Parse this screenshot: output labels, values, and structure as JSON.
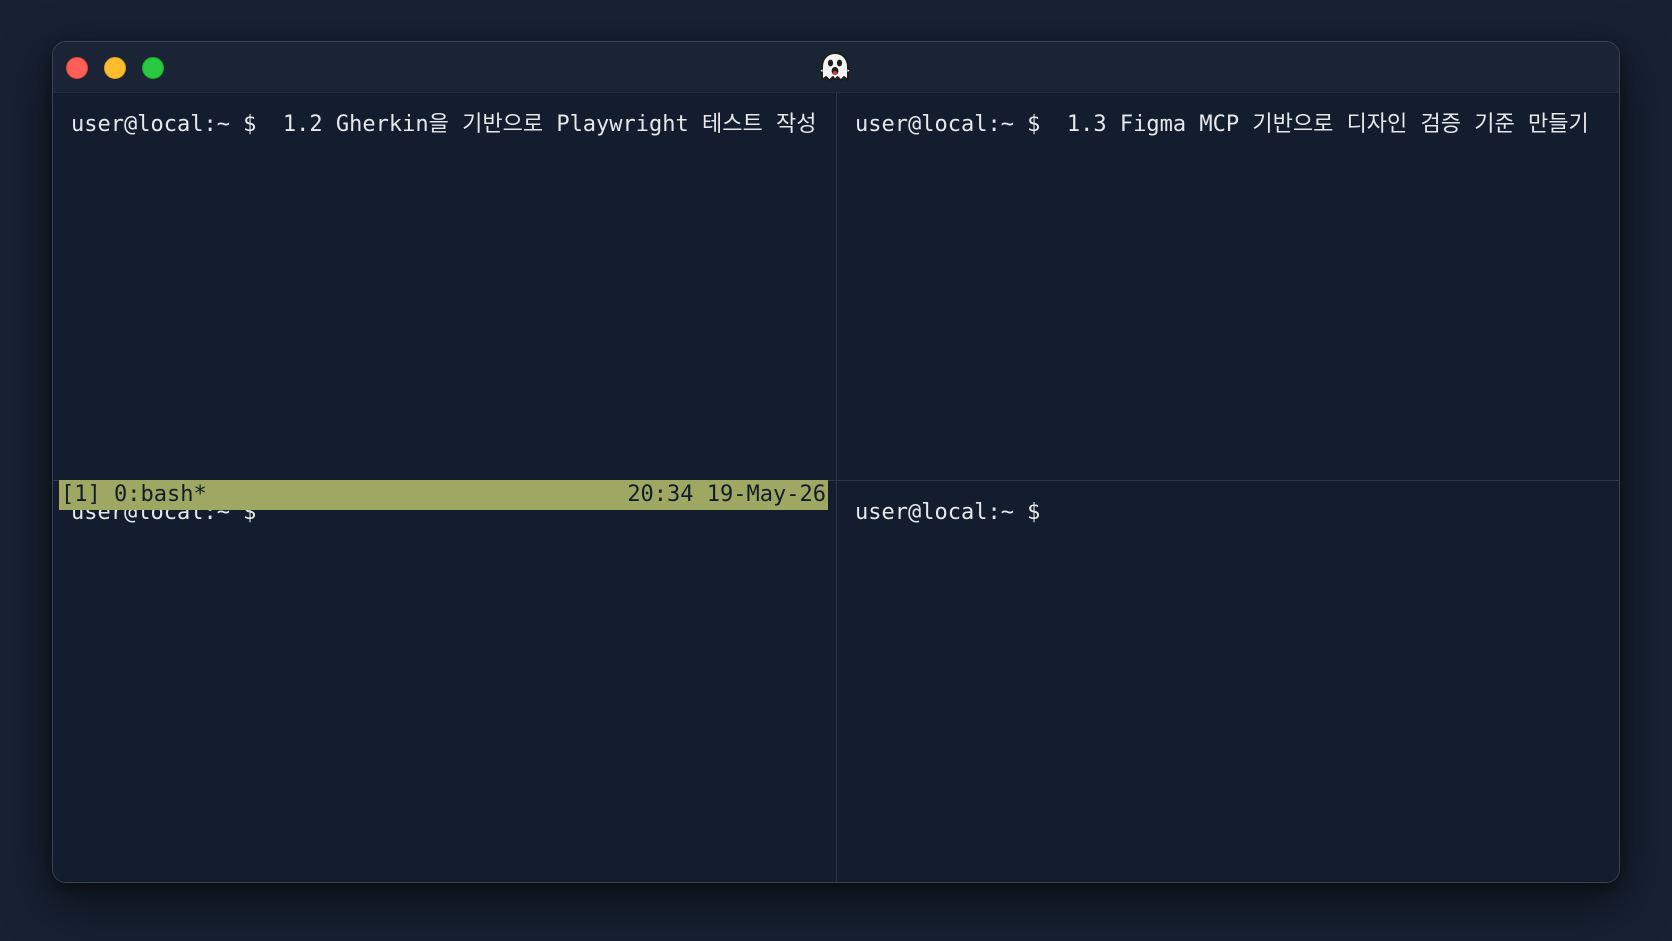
{
  "window": {
    "title_icon": "ghost-icon"
  },
  "panes": {
    "top_left": {
      "prompt": "user@local:~ $ ",
      "command": " 1.2 Gherkin을 기반으로 Playwright 테스트 작성"
    },
    "top_right": {
      "prompt": "user@local:~ $ ",
      "command": " 1.3 Figma MCP 기반으로 디자인 검증 기준 만들기"
    },
    "bottom_left": {
      "prompt": "user@local:~ $ ",
      "command": ""
    },
    "bottom_right": {
      "prompt": "user@local:~ $ ",
      "command": ""
    }
  },
  "statusbar": {
    "session": "[1] 0:bash*",
    "datetime": "20:34  19-May-26",
    "background": "#9fa862"
  },
  "colors": {
    "background": "#172132",
    "terminal_bg": "#131d2d",
    "text": "#e6e8ec",
    "close": "#fe5f57",
    "minimize": "#febc2e",
    "zoom": "#28c840"
  }
}
